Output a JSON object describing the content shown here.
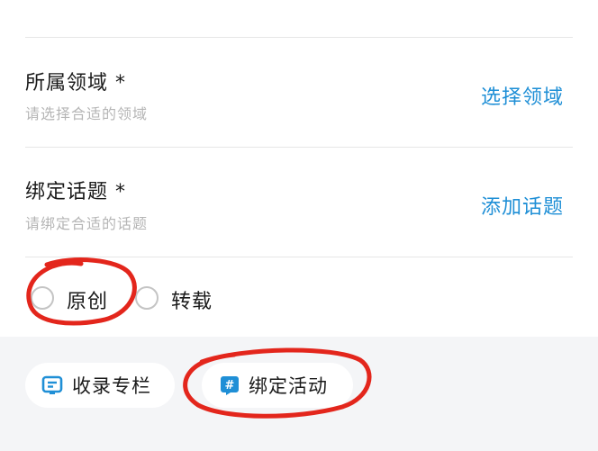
{
  "domain_section": {
    "field_domain": {
      "title": "所属领域 *",
      "hint": "请选择合适的领域",
      "action": "选择领域"
    },
    "field_topic": {
      "title": "绑定话题 *",
      "hint": "请绑定合适的话题",
      "action": "添加话题"
    }
  },
  "article_type": {
    "options": [
      "原创",
      "转载"
    ]
  },
  "bottom_bar": {
    "column_label": "收录专栏",
    "activity_label": "绑定活动",
    "column_icon": "column-list-icon",
    "activity_icon": "hashtag-icon"
  },
  "colors": {
    "accent": "#1f8fd6",
    "annotation": "#e3261c",
    "hint": "#b5b5b5"
  }
}
